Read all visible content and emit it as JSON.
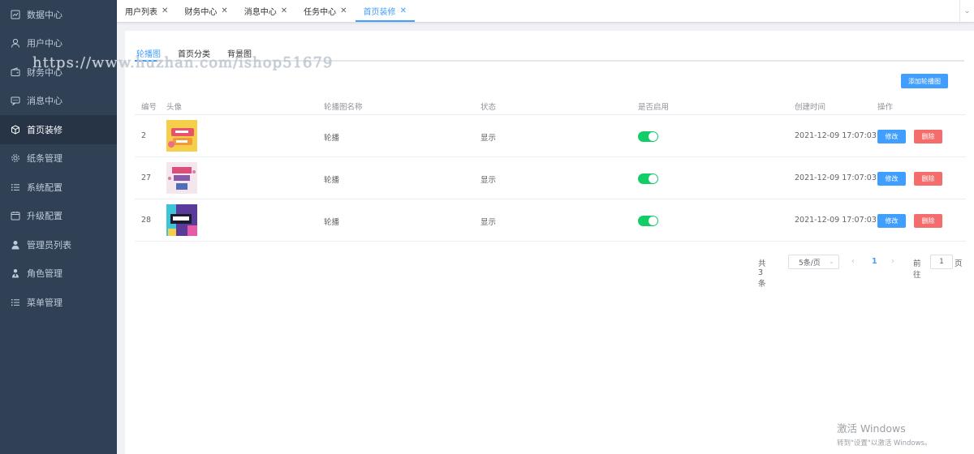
{
  "sidebar": {
    "items": [
      {
        "label": "数据中心",
        "icon": "chart-icon"
      },
      {
        "label": "用户中心",
        "icon": "user-icon"
      },
      {
        "label": "财务中心",
        "icon": "wallet-icon"
      },
      {
        "label": "消息中心",
        "icon": "message-icon"
      },
      {
        "label": "首页装修",
        "icon": "box-icon",
        "active": true
      },
      {
        "label": "纸条管理",
        "icon": "gear-icon"
      },
      {
        "label": "系统配置",
        "icon": "list-icon"
      },
      {
        "label": "升级配置",
        "icon": "calendar-icon"
      },
      {
        "label": "管理员列表",
        "icon": "person-icon"
      },
      {
        "label": "角色管理",
        "icon": "role-icon"
      },
      {
        "label": "菜单管理",
        "icon": "menu-icon"
      }
    ]
  },
  "tabs": [
    {
      "label": "用户列表"
    },
    {
      "label": "财务中心"
    },
    {
      "label": "消息中心"
    },
    {
      "label": "任务中心"
    },
    {
      "label": "首页装修",
      "active": true
    }
  ],
  "watermark": "https://www.huzhan.com/ishop51679",
  "subtabs": [
    {
      "label": "轮播图",
      "active": true
    },
    {
      "label": "首页分类"
    },
    {
      "label": "背景图"
    }
  ],
  "toolbar": {
    "add_label": "添加轮播图"
  },
  "table": {
    "headers": [
      "编号",
      "头像",
      "轮播图名称",
      "状态",
      "是否启用",
      "创建时间",
      "操作"
    ],
    "rows": [
      {
        "id": "2",
        "name": "轮播",
        "status": "显示",
        "enabled": true,
        "created": "2021-12-09 17:07:03"
      },
      {
        "id": "27",
        "name": "轮播",
        "status": "显示",
        "enabled": true,
        "created": "2021-12-09 17:07:03"
      },
      {
        "id": "28",
        "name": "轮播",
        "status": "显示",
        "enabled": true,
        "created": "2021-12-09 17:07:03"
      }
    ],
    "edit_label": "修改",
    "delete_label": "删除"
  },
  "pagination": {
    "total": "共 3 条",
    "page_size": "5条/页",
    "current": "1",
    "goto": "前往",
    "jump_value": "1",
    "page_suffix": "页"
  },
  "windows_watermark": {
    "line1": "激活 Windows",
    "line2": "转到\"设置\"以激活 Windows。"
  },
  "colors": {
    "sidebar": "#304156",
    "primary": "#409eff",
    "danger": "#f56c6c",
    "switch_on": "#13ce66"
  }
}
